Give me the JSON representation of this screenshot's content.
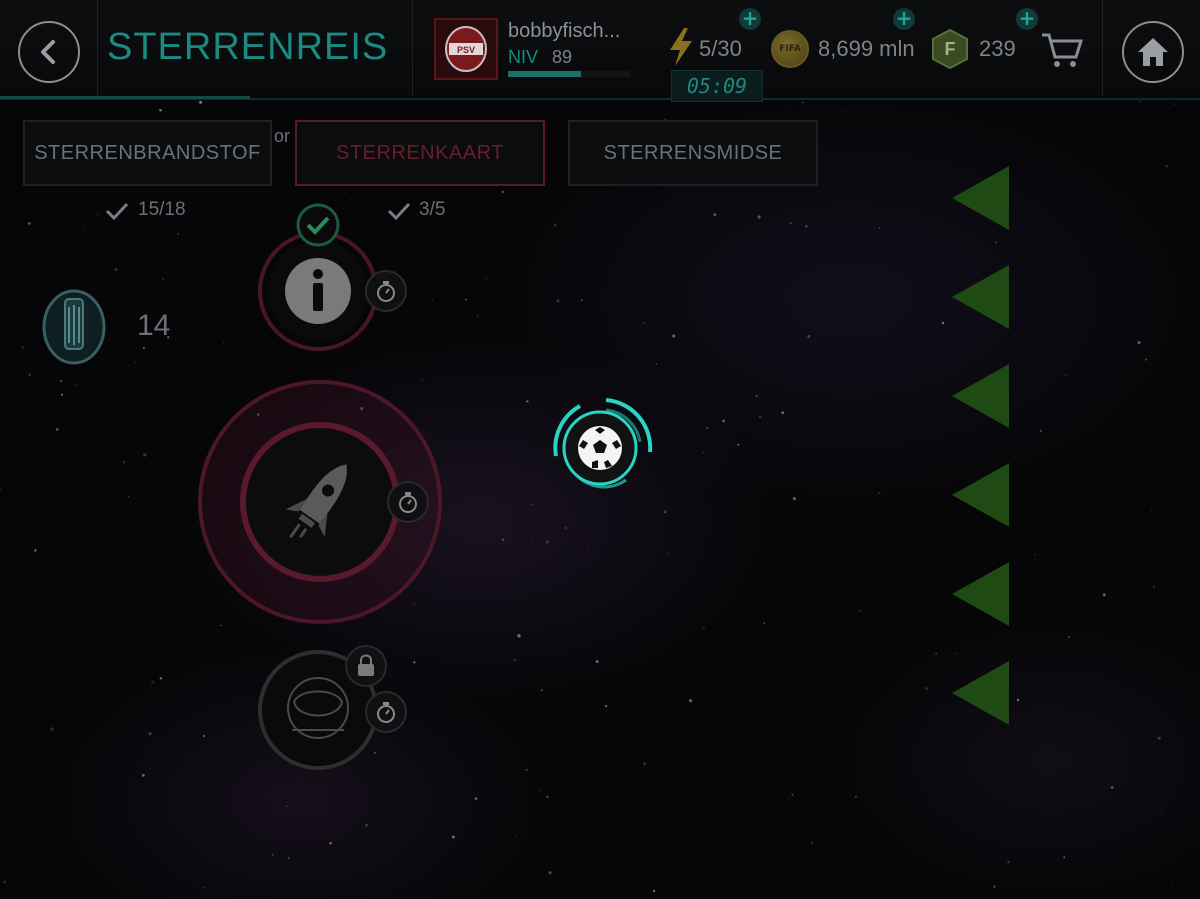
{
  "header": {
    "title": "STERRENREIS",
    "username": "bobbyfisch...",
    "level_label": "NIV",
    "level_value": "89",
    "xp_progress": 0.6,
    "club_badge": "PSV",
    "energy": "5/30",
    "coins": "8,699 mln",
    "fifa_points": "239",
    "coin_icon_text": "FIFA",
    "fifa_points_icon_text": "F",
    "timer": "05:09"
  },
  "tabs": [
    {
      "label": "STERRENBRANDSTOF",
      "progress": "15/18"
    },
    {
      "label": "STERRENKAART",
      "progress": "3/5"
    },
    {
      "label": "STERRENSMIDSE"
    }
  ],
  "or_label": "or",
  "resource_count": "14",
  "colors": {
    "accent": "#1a8a82",
    "active_tab": "#5c1a29",
    "ring_pink": "#5a1a2e",
    "check_green": "#2e8b57",
    "ball_ring": "#2ad4c4",
    "arrow_green": "#1f4a14"
  },
  "icons": [
    "back-arrow-icon",
    "home-icon",
    "lightning-icon",
    "coin-icon",
    "fifa-points-icon",
    "cart-icon",
    "checkmark-icon",
    "info-icon",
    "stopwatch-icon",
    "rocket-icon",
    "lock-icon",
    "helmet-icon",
    "soccer-ball-icon",
    "left-arrow-icon"
  ]
}
